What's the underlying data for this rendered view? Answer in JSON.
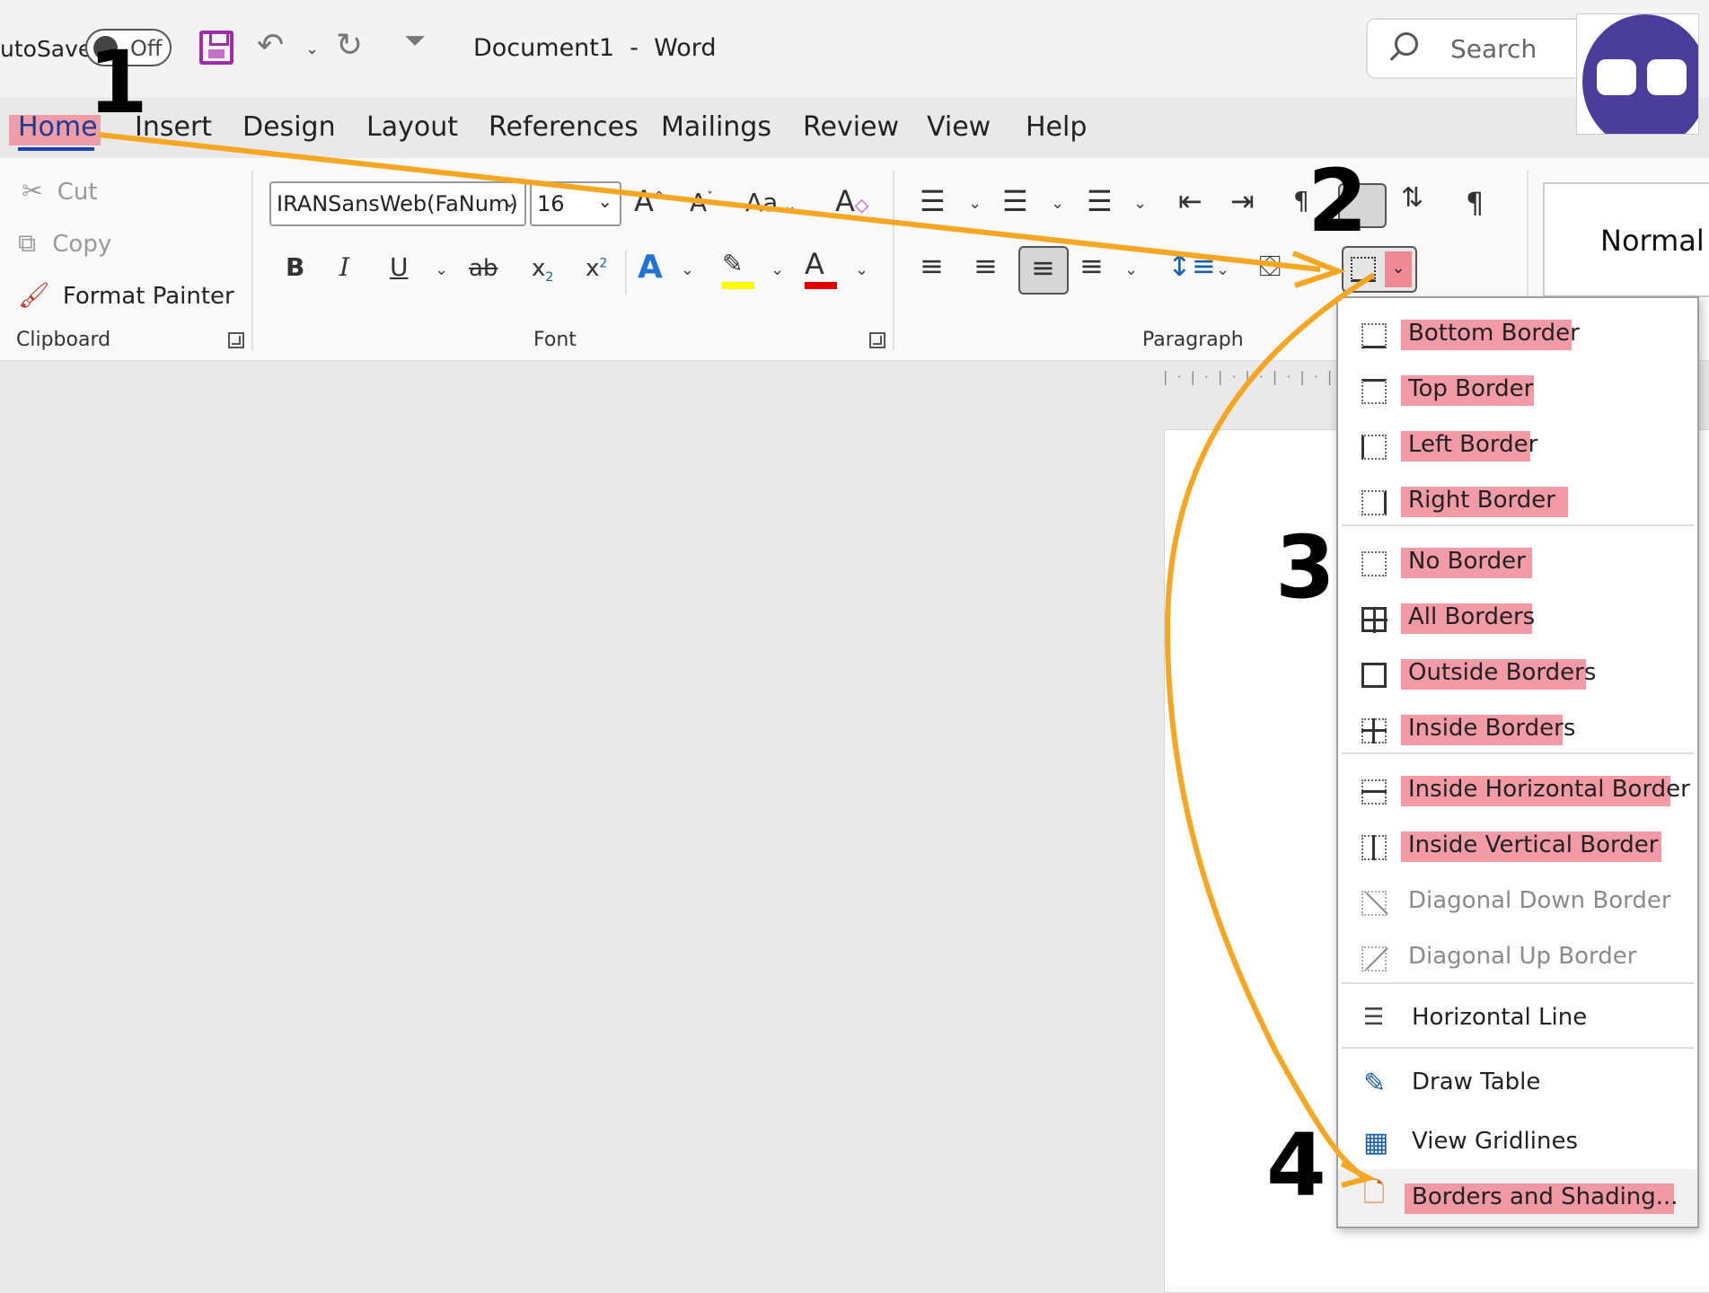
{
  "titlebar": {
    "autosave_label": "utoSave",
    "autosave_state": "Off",
    "doc_title": "Document1  -  Word",
    "search_placeholder": "Search"
  },
  "tabs": [
    "Home",
    "Insert",
    "Design",
    "Layout",
    "References",
    "Mailings",
    "Review",
    "View",
    "Help"
  ],
  "clipboard": {
    "cut": "Cut",
    "copy": "Copy",
    "format_painter": "Format Painter",
    "label": "Clipboard"
  },
  "font": {
    "name": "IRANSansWeb(FaNum)",
    "size": "16",
    "label": "Font",
    "bold": "B",
    "italic": "I",
    "underline": "U",
    "strike": "ab",
    "subscript": "x",
    "superscript": "x",
    "text_effect": "A",
    "font_color": "A",
    "change_case": "Aa",
    "highlight_color": "#ffff00",
    "font_color_value": "#e00000"
  },
  "paragraph": {
    "label": "Paragraph"
  },
  "styles": {
    "normal": "Normal"
  },
  "border_menu": {
    "items": [
      {
        "label": "Bottom Border",
        "highlighted": true
      },
      {
        "label": "Top Border",
        "highlighted": true
      },
      {
        "label": "Left Border",
        "highlighted": true
      },
      {
        "label": "Right Border",
        "highlighted": true
      },
      {
        "label": "No Border",
        "highlighted": true
      },
      {
        "label": "All Borders",
        "highlighted": true
      },
      {
        "label": "Outside Borders",
        "highlighted": true
      },
      {
        "label": "Inside Borders",
        "highlighted": true
      },
      {
        "label": "Inside Horizontal Border",
        "highlighted": true
      },
      {
        "label": "Inside Vertical Border",
        "highlighted": true
      },
      {
        "label": "Diagonal Down Border",
        "highlighted": false
      },
      {
        "label": "Diagonal Up Border",
        "highlighted": false
      },
      {
        "label": "Horizontal Line",
        "highlighted": false
      },
      {
        "label": "Draw Table",
        "highlighted": false
      },
      {
        "label": "View Gridlines",
        "highlighted": false
      },
      {
        "label": "Borders and Shading...",
        "highlighted": true
      }
    ]
  },
  "annotations": {
    "step1": "1",
    "step2": "2",
    "step3": "3",
    "step4": "4",
    "highlight_color": "#f08a97",
    "arrow_color": "#f5a623"
  }
}
